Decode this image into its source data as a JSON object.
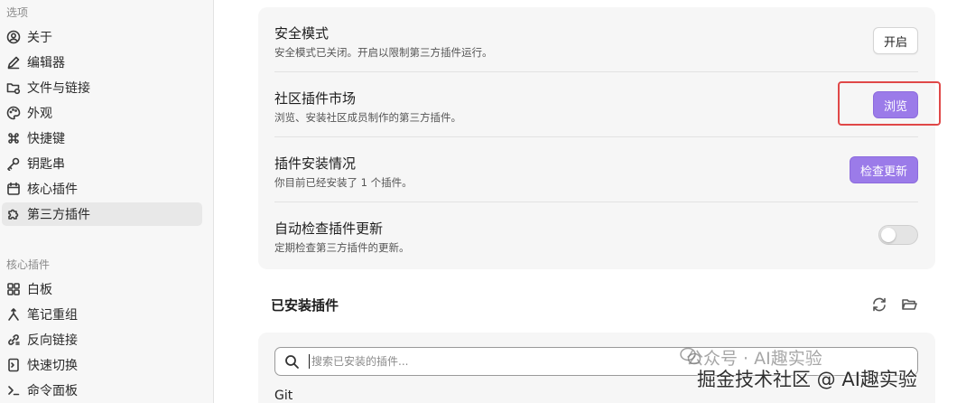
{
  "sidebar": {
    "section_options": "选项",
    "options": [
      {
        "label": "关于",
        "icon": "user-circle-icon"
      },
      {
        "label": "编辑器",
        "icon": "pen-icon"
      },
      {
        "label": "文件与链接",
        "icon": "folder-icon"
      },
      {
        "label": "外观",
        "icon": "palette-icon"
      },
      {
        "label": "快捷键",
        "icon": "command-icon"
      },
      {
        "label": "钥匙串",
        "icon": "key-icon"
      },
      {
        "label": "核心插件",
        "icon": "calendar-icon"
      },
      {
        "label": "第三方插件",
        "icon": "puzzle-icon",
        "active": true
      }
    ],
    "section_core": "核心插件",
    "core": [
      {
        "label": "白板",
        "icon": "grid-icon"
      },
      {
        "label": "笔记重组",
        "icon": "merge-icon"
      },
      {
        "label": "反向链接",
        "icon": "backlink-icon"
      },
      {
        "label": "快速切换",
        "icon": "switch-icon"
      },
      {
        "label": "命令面板",
        "icon": "terminal-icon"
      }
    ]
  },
  "settings": {
    "safe_mode": {
      "title": "安全模式",
      "desc": "安全模式已关闭。开启以限制第三方插件运行。",
      "button": "开启"
    },
    "community": {
      "title": "社区插件市场",
      "desc": "浏览、安装社区成员制作的第三方插件。",
      "button": "浏览"
    },
    "installed_status": {
      "title": "插件安装情况",
      "desc": "你目前已经安装了 1 个插件。",
      "button": "检查更新"
    },
    "auto_update": {
      "title": "自动检查插件更新",
      "desc": "定期检查第三方插件的更新。",
      "toggle_on": false
    }
  },
  "installed": {
    "title": "已安装插件",
    "search_placeholder": "搜索已安装的插件...",
    "first_item": "Git"
  },
  "watermark": {
    "line1": "公众号 · AI趣实验",
    "line2": "掘金技术社区 @ AI趣实验"
  },
  "colors": {
    "accent": "#9b7be9",
    "highlight": "#e04848"
  }
}
